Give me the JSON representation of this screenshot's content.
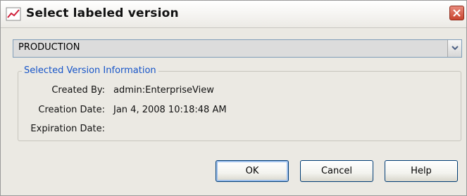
{
  "window": {
    "title": "Select labeled version",
    "app_icon": "chart-line-icon",
    "close_icon": "close-icon"
  },
  "version_select": {
    "selected": "PRODUCTION",
    "arrow_icon": "chevron-down-icon"
  },
  "info_group": {
    "title": "Selected Version Information",
    "created_by_label": "Created By:",
    "created_by_value": "admin:EnterpriseView",
    "creation_date_label": "Creation Date:",
    "creation_date_value": "Jan 4, 2008 10:18:48 AM",
    "expiration_date_label": "Expiration Date:",
    "expiration_date_value": ""
  },
  "buttons": {
    "ok": "OK",
    "cancel": "Cancel",
    "help": "Help"
  },
  "colors": {
    "dialog_bg": "#ebe9e3",
    "group_title": "#1654c8",
    "close_button": "#c8442f"
  }
}
